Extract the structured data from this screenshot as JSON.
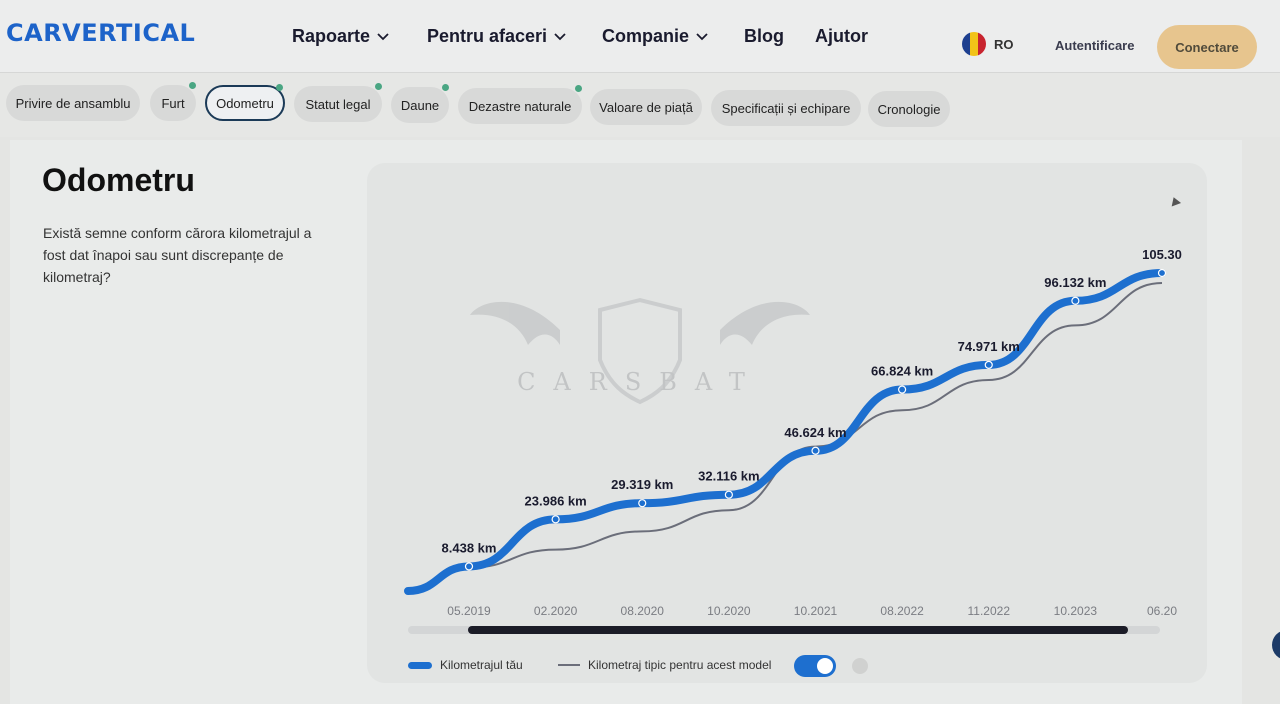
{
  "header": {
    "logo": "CARVERTICAL",
    "nav": [
      {
        "label": "Rapoarte",
        "dropdown": true
      },
      {
        "label": "Pentru afaceri",
        "dropdown": true
      },
      {
        "label": "Companie",
        "dropdown": true
      },
      {
        "label": "Blog",
        "dropdown": false
      },
      {
        "label": "Ajutor",
        "dropdown": false
      }
    ],
    "language": "RO",
    "login": "Autentificare",
    "connect": "Conectare"
  },
  "tabs": [
    {
      "label": "Privire de ansamblu",
      "dot": false,
      "active": false
    },
    {
      "label": "Furt",
      "dot": true,
      "active": false
    },
    {
      "label": "Odometru",
      "dot": true,
      "active": true
    },
    {
      "label": "Statut legal",
      "dot": true,
      "active": false
    },
    {
      "label": "Daune",
      "dot": true,
      "active": false
    },
    {
      "label": "Dezastre naturale",
      "dot": true,
      "active": false
    },
    {
      "label": "Valoare de piață",
      "dot": false,
      "active": false
    },
    {
      "label": "Specificații și echipare",
      "dot": false,
      "active": false
    },
    {
      "label": "Cronologie",
      "dot": false,
      "active": false
    }
  ],
  "section": {
    "title": "Odometru",
    "description": "Există semne conform cărora kilometrajul a fost dat înapoi sau sunt discrepanțe de kilometraj?"
  },
  "watermark": "CARSBAT",
  "legend": {
    "series1": "Kilometrajul tău",
    "series2": "Kilometraj tipic pentru acest model",
    "toggle_on": true
  },
  "colors": {
    "accent": "#1d6fcf",
    "typical": "#6b6e7a",
    "brand": "#1d63c9",
    "cta": "#e7c58e"
  },
  "chart_data": {
    "type": "line",
    "x": [
      "05.2019",
      "02.2020",
      "08.2020",
      "10.2020",
      "10.2021",
      "08.2022",
      "11.2022",
      "10.2023",
      "06.20"
    ],
    "series": [
      {
        "name": "Kilometrajul tău",
        "values": [
          8438,
          23986,
          29319,
          32116,
          46624,
          66824,
          74971,
          96132,
          105300
        ],
        "labels": [
          "8.438 km",
          "23.986 km",
          "29.319 km",
          "32.116 km",
          "46.624 km",
          "66.824 km",
          "74.971 km",
          "96.132 km",
          "105.30"
        ]
      },
      {
        "name": "Kilometraj tipic pentru acest model",
        "values": [
          8000,
          14000,
          20000,
          27000,
          48000,
          60000,
          70000,
          88000,
          102000
        ]
      }
    ],
    "grid": false,
    "legend_position": "bottom-left"
  }
}
